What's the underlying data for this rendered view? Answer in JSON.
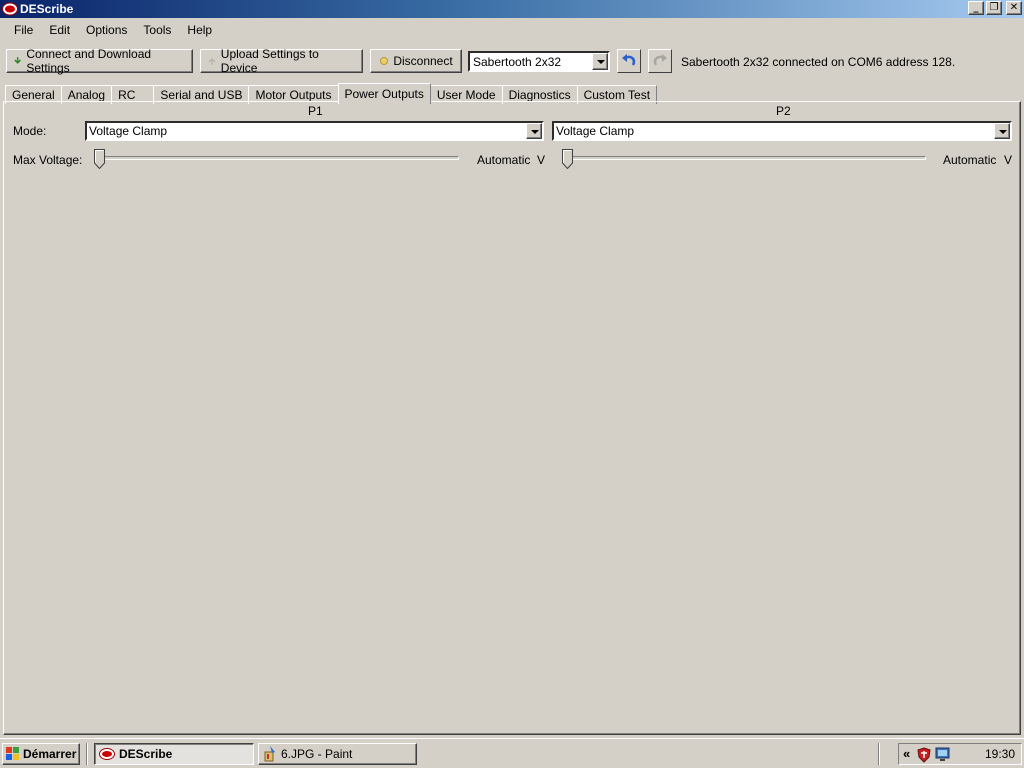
{
  "window": {
    "title": "DEScribe",
    "minimize": "_",
    "maximize": "❐",
    "close": "✕"
  },
  "menu": [
    "File",
    "Edit",
    "Options",
    "Tools",
    "Help"
  ],
  "toolbar": {
    "connect_label": "Connect and Download Settings",
    "upload_label": "Upload Settings to Device",
    "disconnect_label": "Disconnect",
    "device_selected": "Sabertooth 2x32",
    "status": "Sabertooth 2x32 connected on COM6 address 128."
  },
  "tabs": [
    "General",
    "Analog",
    "RC",
    "Serial and USB",
    "Motor Outputs",
    "Power Outputs",
    "User Mode",
    "Diagnostics",
    "Custom Test"
  ],
  "active_tab": "Power Outputs",
  "power_outputs": {
    "p1_header": "P1",
    "p2_header": "P2",
    "mode_label": "Mode:",
    "max_voltage_label": "Max Voltage:",
    "p1_mode": "Voltage Clamp",
    "p2_mode": "Voltage Clamp",
    "p1_value": "Automatic",
    "p2_value": "Automatic",
    "unit": "V"
  },
  "taskbar": {
    "start_label": "Démarrer",
    "tasks": [
      "DEScribe",
      "6.JPG - Paint"
    ],
    "tray_chevron": "«",
    "clock": "19:30"
  },
  "colors": {
    "titlebar_start": "#0a246a",
    "titlebar_end": "#a6caf0",
    "face": "#d4d0c8",
    "undo_blue": "#2a62c9"
  }
}
